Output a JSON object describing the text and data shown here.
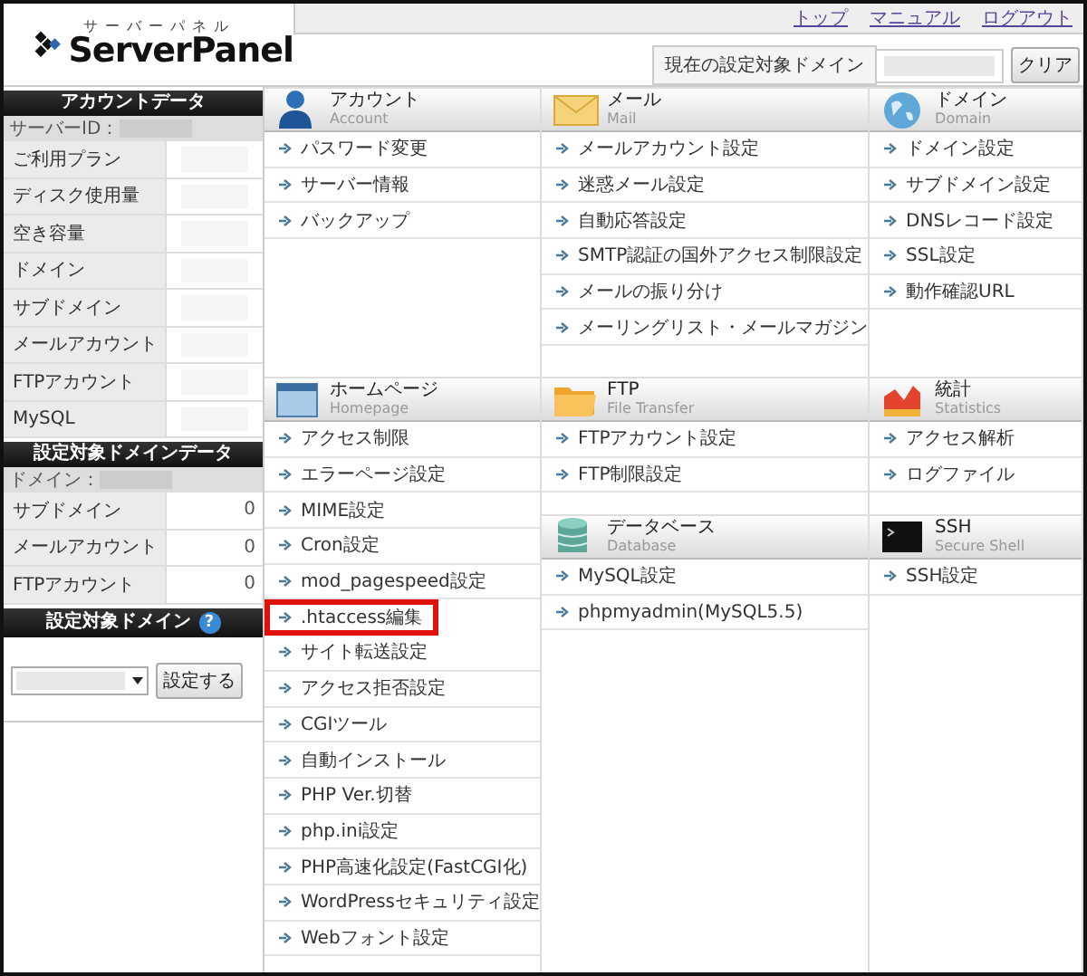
{
  "header": {
    "logo_kana": "サーバーパネル",
    "logo_name": "ServerPanel",
    "links": [
      "トップ",
      "マニュアル",
      "ログアウト"
    ],
    "domain_label": "現在の設定対象ドメイン",
    "clear_button": "クリア"
  },
  "sidebar": {
    "account": {
      "title": "アカウントデータ",
      "server_id_label": "サーバーID：",
      "rows": [
        {
          "label": "ご利用プラン"
        },
        {
          "label": "ディスク使用量"
        },
        {
          "label": "空き容量"
        },
        {
          "label": "ドメイン"
        },
        {
          "label": "サブドメイン"
        },
        {
          "label": "メールアカウント"
        },
        {
          "label": "FTPアカウント"
        },
        {
          "label": "MySQL"
        }
      ]
    },
    "domain_data": {
      "title": "設定対象ドメインデータ",
      "domain_label": "ドメイン：",
      "rows": [
        {
          "label": "サブドメイン",
          "value": "0"
        },
        {
          "label": "メールアカウント",
          "value": "0"
        },
        {
          "label": "FTPアカウント",
          "value": "0"
        }
      ]
    },
    "domain_select": {
      "title": "設定対象ドメイン",
      "help": "?",
      "button": "設定する"
    }
  },
  "columns": [
    [
      {
        "title": "アカウント",
        "subtitle": "Account",
        "items": [
          {
            "label": "パスワード変更",
            "highlighted": false
          },
          {
            "label": "サーバー情報",
            "highlighted": false
          },
          {
            "label": "バックアップ",
            "highlighted": false
          }
        ]
      },
      {
        "title": "ホームページ",
        "subtitle": "Homepage",
        "items": [
          {
            "label": "アクセス制限",
            "highlighted": false
          },
          {
            "label": "エラーページ設定",
            "highlighted": false
          },
          {
            "label": "MIME設定",
            "highlighted": false
          },
          {
            "label": "Cron設定",
            "highlighted": false
          },
          {
            "label": "mod_pagespeed設定",
            "highlighted": false
          },
          {
            "label": ".htaccess編集",
            "highlighted": true
          },
          {
            "label": "サイト転送設定",
            "highlighted": false
          },
          {
            "label": "アクセス拒否設定",
            "highlighted": false
          },
          {
            "label": "CGIツール",
            "highlighted": false
          },
          {
            "label": "自動インストール",
            "highlighted": false
          },
          {
            "label": "PHP Ver.切替",
            "highlighted": false
          },
          {
            "label": "php.ini設定",
            "highlighted": false
          },
          {
            "label": "PHP高速化設定(FastCGI化)",
            "highlighted": false
          },
          {
            "label": "WordPressセキュリティ設定",
            "highlighted": false
          },
          {
            "label": "Webフォント設定",
            "highlighted": false
          }
        ]
      }
    ],
    [
      {
        "title": "メール",
        "subtitle": "Mail",
        "items": [
          {
            "label": "メールアカウント設定",
            "highlighted": false
          },
          {
            "label": "迷惑メール設定",
            "highlighted": false
          },
          {
            "label": "自動応答設定",
            "highlighted": false
          },
          {
            "label": "SMTP認証の国外アクセス制限設定",
            "highlighted": false
          },
          {
            "label": "メールの振り分け",
            "highlighted": false
          },
          {
            "label": "メーリングリスト・メールマガジン",
            "highlighted": false
          }
        ]
      },
      {
        "title": "FTP",
        "subtitle": "File Transfer",
        "items": [
          {
            "label": "FTPアカウント設定",
            "highlighted": false
          },
          {
            "label": "FTP制限設定",
            "highlighted": false
          }
        ]
      },
      {
        "title": "データベース",
        "subtitle": "Database",
        "items": [
          {
            "label": "MySQL設定",
            "highlighted": false
          },
          {
            "label": "phpmyadmin(MySQL5.5)",
            "highlighted": false
          }
        ]
      }
    ],
    [
      {
        "title": "ドメイン",
        "subtitle": "Domain",
        "items": [
          {
            "label": "ドメイン設定",
            "highlighted": false
          },
          {
            "label": "サブドメイン設定",
            "highlighted": false
          },
          {
            "label": "DNSレコード設定",
            "highlighted": false
          },
          {
            "label": "SSL設定",
            "highlighted": false
          },
          {
            "label": "動作確認URL",
            "highlighted": false
          }
        ]
      },
      {
        "title": "統計",
        "subtitle": "Statistics",
        "items": [
          {
            "label": "アクセス解析",
            "highlighted": false
          },
          {
            "label": "ログファイル",
            "highlighted": false
          }
        ]
      },
      {
        "title": "SSH",
        "subtitle": "Secure Shell",
        "items": [
          {
            "label": "SSH設定",
            "highlighted": false
          }
        ]
      }
    ]
  ]
}
